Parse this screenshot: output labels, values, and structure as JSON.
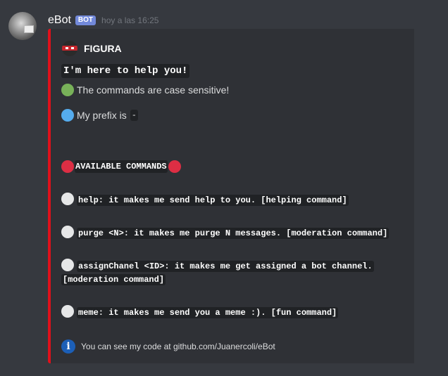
{
  "message": {
    "username": "eBot",
    "bot_tag": "BOT",
    "timestamp": "hoy a las 16:25"
  },
  "embed": {
    "accent_color": "#e0101b",
    "author": {
      "name": "FIGURA",
      "icon": "mask-avatar-icon"
    },
    "title": "I'm here to help you!",
    "case_line": {
      "icon": "green-circle-icon",
      "text": "The commands are case sensitive!"
    },
    "prefix_line": {
      "icon": "blue-circle-icon",
      "text": "My prefix is",
      "prefix": "-"
    },
    "section_heading": {
      "icon": "red-circle-icon",
      "text": "AVAILABLE COMMANDS"
    },
    "commands": [
      {
        "icon": "white-circle-icon",
        "text": "help: it makes me send help to you. [helping command]"
      },
      {
        "icon": "white-circle-icon",
        "text": "purge <N>: it makes me purge N messages. [moderation command]"
      },
      {
        "icon": "white-circle-icon",
        "text": "assignChanel <ID>: it makes me get assigned a bot channel. [moderation command]"
      },
      {
        "icon": "white-circle-icon",
        "text": "meme: it makes me send you a meme :). [fun command]"
      }
    ],
    "footer": {
      "icon": "info-icon",
      "text": "You can see my code at github.com/Juanercoli/eBot"
    }
  }
}
